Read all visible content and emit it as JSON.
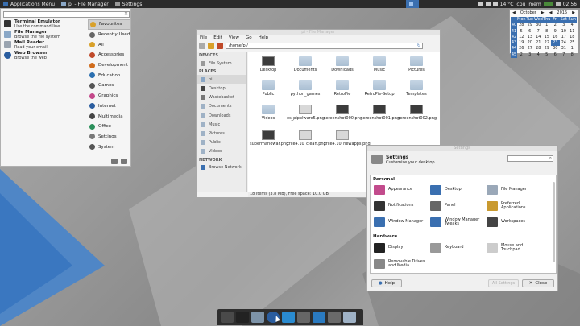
{
  "top_panel": {
    "apps_menu": "Applications Menu",
    "tasks": [
      {
        "label": "pi - File Manager",
        "icon": "folder-icon"
      },
      {
        "label": "Settings",
        "icon": "settings-icon"
      }
    ],
    "temperature": "14 °C",
    "cpu_label": "cpu",
    "mem_label": "mem",
    "clock": "02:56"
  },
  "app_menu": {
    "favourites": [
      {
        "title": "Terminal Emulator",
        "subtitle": "Use the command line",
        "icon": "terminal-icon",
        "color": "#333333"
      },
      {
        "title": "File Manager",
        "subtitle": "Browse the file system",
        "icon": "file-manager-icon",
        "color": "#8aa7c6"
      },
      {
        "title": "Mail Reader",
        "subtitle": "Read your email",
        "icon": "mail-icon",
        "color": "#9aa4b0"
      },
      {
        "title": "Web Browser",
        "subtitle": "Browse the web",
        "icon": "globe-icon",
        "color": "#2a5d9f"
      }
    ],
    "categories": [
      {
        "label": "Favourites",
        "icon": "star-icon",
        "color": "#d9a12a"
      },
      {
        "label": "Recently Used",
        "icon": "clock-icon",
        "color": "#666666"
      },
      {
        "label": "All",
        "icon": "all-icon",
        "color": "#d9a12a"
      },
      {
        "label": "Accessories",
        "icon": "accessories-icon",
        "color": "#c04a2a"
      },
      {
        "label": "Development",
        "icon": "development-icon",
        "color": "#d06b1a"
      },
      {
        "label": "Education",
        "icon": "education-icon",
        "color": "#2a6fb0"
      },
      {
        "label": "Games",
        "icon": "games-icon",
        "color": "#555555"
      },
      {
        "label": "Graphics",
        "icon": "graphics-icon",
        "color": "#c4488a"
      },
      {
        "label": "Internet",
        "icon": "internet-icon",
        "color": "#2a5d9f"
      },
      {
        "label": "Multimedia",
        "icon": "multimedia-icon",
        "color": "#444444"
      },
      {
        "label": "Office",
        "icon": "office-icon",
        "color": "#2a8f5a"
      },
      {
        "label": "Settings",
        "icon": "settings-icon",
        "color": "#777777"
      },
      {
        "label": "System",
        "icon": "system-icon",
        "color": "#555555"
      }
    ]
  },
  "file_manager": {
    "title": "pi - File Manager",
    "menu": [
      "File",
      "Edit",
      "View",
      "Go",
      "Help"
    ],
    "path": "/home/pi/",
    "sidebar": {
      "devices_heading": "DEVICES",
      "devices": [
        {
          "label": "File System",
          "icon": "drive-icon"
        }
      ],
      "places_heading": "PLACES",
      "places": [
        {
          "label": "pi",
          "icon": "home-icon",
          "active": true
        },
        {
          "label": "Desktop",
          "icon": "desktop-icon"
        },
        {
          "label": "Wastebasket",
          "icon": "trash-icon"
        },
        {
          "label": "Documents",
          "icon": "documents-icon"
        },
        {
          "label": "Downloads",
          "icon": "downloads-icon"
        },
        {
          "label": "Music",
          "icon": "music-icon"
        },
        {
          "label": "Pictures",
          "icon": "pictures-icon"
        },
        {
          "label": "Public",
          "icon": "public-icon"
        },
        {
          "label": "Videos",
          "icon": "videos-icon"
        }
      ],
      "network_heading": "NETWORK",
      "network": [
        {
          "label": "Browse Network",
          "icon": "network-icon"
        }
      ]
    },
    "files": [
      {
        "label": "Desktop",
        "type": "thumb"
      },
      {
        "label": "Documents",
        "type": "folder"
      },
      {
        "label": "Downloads",
        "type": "folder"
      },
      {
        "label": "Music",
        "type": "folder"
      },
      {
        "label": "Pictures",
        "type": "folder"
      },
      {
        "label": "Public",
        "type": "folder"
      },
      {
        "label": "python_games",
        "type": "folder"
      },
      {
        "label": "RetroPie",
        "type": "folder"
      },
      {
        "label": "RetroPie-Setup",
        "type": "folder"
      },
      {
        "label": "Templates",
        "type": "folder"
      },
      {
        "label": "Videos",
        "type": "folder"
      },
      {
        "label": "es_pipplware5.png",
        "type": "image"
      },
      {
        "label": "screenshot000.png",
        "type": "image"
      },
      {
        "label": "screenshot001.png",
        "type": "image"
      },
      {
        "label": "screenshot002.png",
        "type": "image"
      },
      {
        "label": "supermariowar.png",
        "type": "image"
      },
      {
        "label": "xfce4.10_clean.png",
        "type": "image-light"
      },
      {
        "label": "xfce4.10_newapps.png",
        "type": "image-light"
      }
    ],
    "status": "18 items (3.8 MB), Free space: 10.0 GB"
  },
  "settings": {
    "title": "Settings",
    "heading": "Settings",
    "subheading": "Customise your desktop",
    "sections": [
      {
        "name": "Personal",
        "items": [
          {
            "label": "Appearance",
            "icon": "appearance-icon",
            "color": "#c24b8c"
          },
          {
            "label": "Desktop",
            "icon": "desktop-icon",
            "color": "#3a6fb0"
          },
          {
            "label": "File Manager",
            "icon": "file-manager-icon",
            "color": "#9aa8b8"
          },
          {
            "label": "Notifications",
            "icon": "notifications-icon",
            "color": "#333333"
          },
          {
            "label": "Panel",
            "icon": "panel-icon",
            "color": "#666666"
          },
          {
            "label": "Preferred Applications",
            "icon": "preferred-apps-icon",
            "color": "#c99a30"
          },
          {
            "label": "Window Manager",
            "icon": "window-manager-icon",
            "color": "#3a6fb0"
          },
          {
            "label": "Window Manager Tweaks",
            "icon": "wm-tweaks-icon",
            "color": "#3a6fb0"
          },
          {
            "label": "Workspaces",
            "icon": "workspaces-icon",
            "color": "#444444"
          }
        ]
      },
      {
        "name": "Hardware",
        "items": [
          {
            "label": "Display",
            "icon": "display-icon",
            "color": "#222222"
          },
          {
            "label": "Keyboard",
            "icon": "keyboard-icon",
            "color": "#999999"
          },
          {
            "label": "Mouse and Touchpad",
            "icon": "mouse-icon",
            "color": "#cccccc"
          },
          {
            "label": "Removable Drives and Media",
            "icon": "drive-icon",
            "color": "#888888"
          }
        ]
      }
    ],
    "help": "Help",
    "all_settings": "All Settings",
    "close": "Close"
  },
  "calendar": {
    "month": "October",
    "year": "2015",
    "days": [
      "Mon",
      "Tue",
      "Wed",
      "Thu",
      "Fri",
      "Sat",
      "Sun"
    ],
    "weeks": [
      {
        "wk": "40",
        "d": [
          "28",
          "29",
          "30",
          "1",
          "2",
          "3",
          "4"
        ]
      },
      {
        "wk": "41",
        "d": [
          "5",
          "6",
          "7",
          "8",
          "9",
          "10",
          "11"
        ]
      },
      {
        "wk": "42",
        "d": [
          "12",
          "13",
          "14",
          "15",
          "16",
          "17",
          "18"
        ]
      },
      {
        "wk": "43",
        "d": [
          "19",
          "20",
          "21",
          "22",
          "23",
          "24",
          "25"
        ]
      },
      {
        "wk": "44",
        "d": [
          "26",
          "27",
          "28",
          "29",
          "30",
          "31",
          "1"
        ]
      },
      {
        "wk": "45",
        "d": [
          "2",
          "3",
          "4",
          "5",
          "6",
          "7",
          "8"
        ]
      }
    ],
    "today": "23"
  },
  "dock": [
    {
      "icon": "show-desktop-icon",
      "color": "#4a4a4a"
    },
    {
      "icon": "terminal-icon",
      "color": "#222222"
    },
    {
      "icon": "file-manager-icon",
      "color": "#7d93a8"
    },
    {
      "icon": "browser-icon",
      "color": "#2a5d9f"
    },
    {
      "icon": "kodi-icon",
      "color": "#2a8bd0"
    },
    {
      "icon": "retropie-icon",
      "color": "#666666"
    },
    {
      "icon": "downloads-icon",
      "color": "#2a7ac0"
    },
    {
      "icon": "search-icon",
      "color": "#6a6a6a"
    },
    {
      "icon": "folder-icon",
      "color": "#9fb2c6"
    }
  ]
}
